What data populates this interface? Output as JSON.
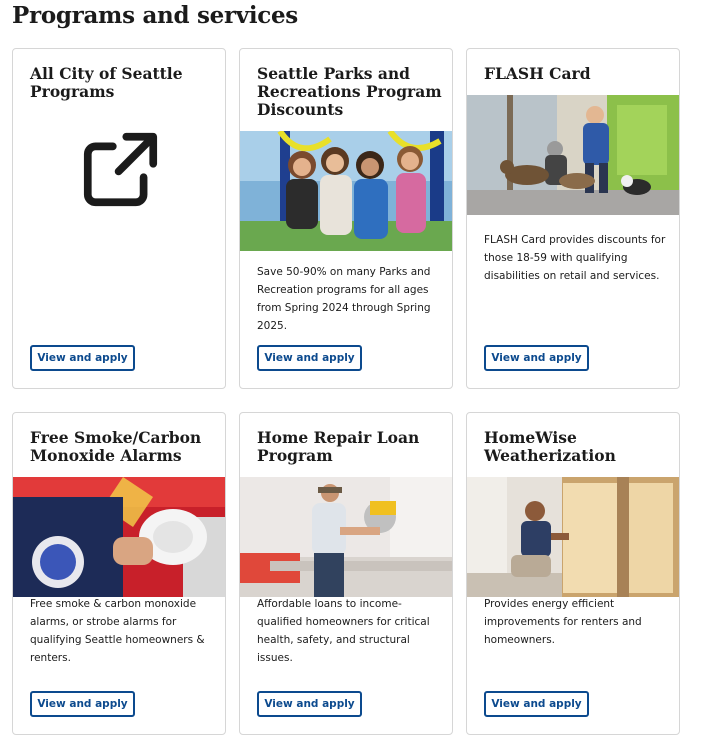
{
  "page": {
    "title": "Programs and services"
  },
  "cards": [
    {
      "title": "All City of Seattle Programs",
      "description": "",
      "button": "View and apply",
      "icon": "external-link-icon"
    },
    {
      "title": "Seattle Parks and Recreations Program Discounts",
      "description": "Save 50-90% on many Parks and Recreation programs for all ages from Spring 2024 through Spring 2025.",
      "button": "View and apply",
      "image": "children-on-playground-photo"
    },
    {
      "title": "FLASH Card",
      "description": "FLASH Card provides discounts for those 18-59 with qualifying disabilities on retail and services.",
      "button": "View and apply",
      "image": "people-with-dogs-photo"
    },
    {
      "title": "Free Smoke/Carbon Monoxide Alarms",
      "description": "Free smoke & carbon monoxide alarms, or strobe alarms for qualifying Seattle homeowners & renters.",
      "button": "View and apply",
      "image": "firefighter-holding-alarm-photo"
    },
    {
      "title": "Home Repair Loan Program",
      "description": "Affordable loans to income-qualified homeowners for critical health, safety, and structural issues.",
      "button": "View and apply",
      "image": "man-using-saw-photo"
    },
    {
      "title": "HomeWise Weatherization",
      "description": "Provides energy efficient improvements for renters and homeowners.",
      "button": "View and apply",
      "image": "woman-installing-insulation-photo"
    }
  ],
  "colors": {
    "accent": "#0c4a8e",
    "border": "#d6d6d6",
    "text": "#1b1b1b"
  }
}
